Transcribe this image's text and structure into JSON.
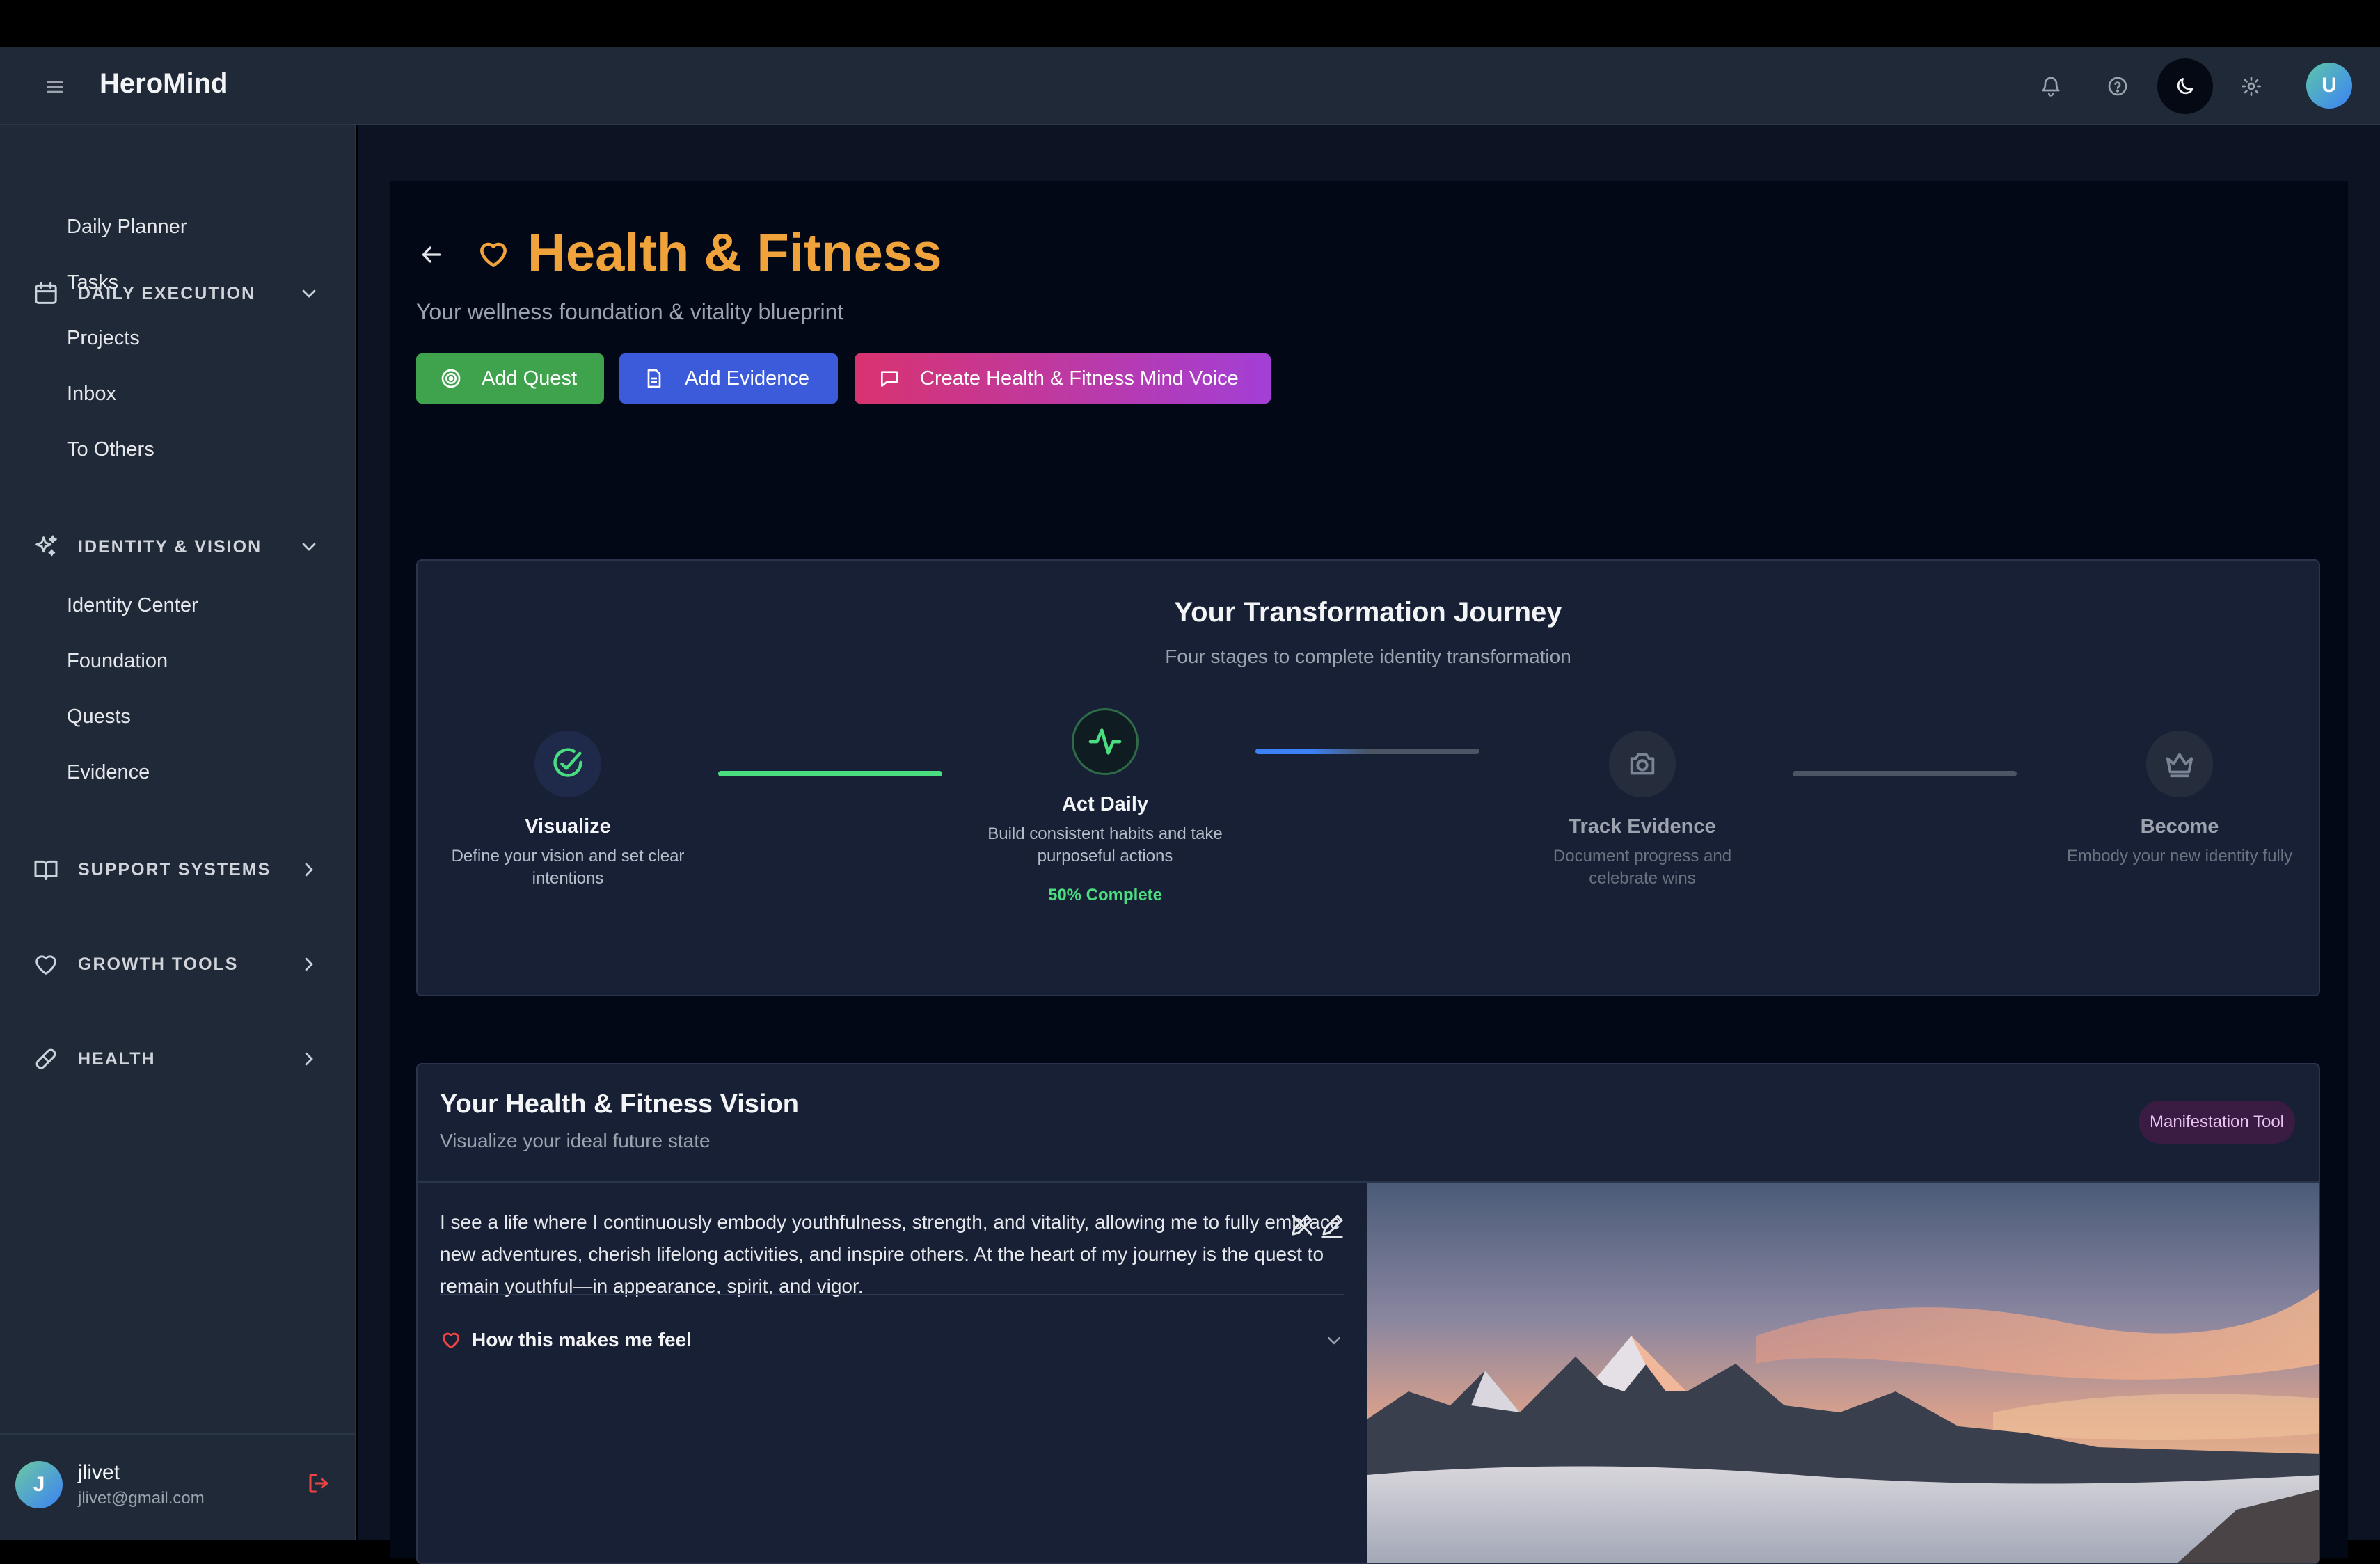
{
  "app": {
    "name": "HeroMind"
  },
  "topbar": {
    "icons": [
      "bell-icon",
      "help-icon",
      "moon-icon",
      "gear-icon"
    ],
    "avatar_initial": "U"
  },
  "sidebar": {
    "sections": [
      {
        "title": "DAILY EXECUTION",
        "icon": "calendar-icon",
        "expanded": true,
        "items": [
          "Daily Planner",
          "Tasks",
          "Projects",
          "Inbox",
          "To Others"
        ]
      },
      {
        "title": "IDENTITY & VISION",
        "icon": "sparkles-icon",
        "expanded": true,
        "items": [
          "Identity Center",
          "Foundation",
          "Quests",
          "Evidence"
        ]
      },
      {
        "title": "SUPPORT SYSTEMS",
        "icon": "book-icon",
        "expanded": false,
        "items": []
      },
      {
        "title": "GROWTH TOOLS",
        "icon": "heart-icon",
        "expanded": false,
        "items": []
      },
      {
        "title": "HEALTH",
        "icon": "pill-icon",
        "expanded": false,
        "items": []
      }
    ],
    "user": {
      "initial": "J",
      "name": "jlivet",
      "email": "jlivet@gmail.com"
    }
  },
  "page": {
    "title": "Health & Fitness",
    "subtitle": "Your wellness foundation & vitality blueprint",
    "buttons": {
      "add_quest": "Add Quest",
      "add_evidence": "Add Evidence",
      "mind_voice": "Create Health & Fitness Mind Voice"
    }
  },
  "journey": {
    "title": "Your Transformation Journey",
    "subtitle": "Four stages to complete identity transformation",
    "stages": [
      {
        "name": "Visualize",
        "desc": "Define your vision and set clear intentions",
        "state": "complete"
      },
      {
        "name": "Act Daily",
        "desc": "Build consistent habits and take purposeful actions",
        "state": "active",
        "progress_label": "50% Complete",
        "progress": 0.5
      },
      {
        "name": "Track Evidence",
        "desc": "Document progress and celebrate wins",
        "state": "locked"
      },
      {
        "name": "Become",
        "desc": "Embody your new identity fully",
        "state": "locked"
      }
    ],
    "colors": {
      "complete": "#4ade80",
      "active": "#3b82f6",
      "inactive": "#4b5563"
    }
  },
  "vision": {
    "title": "Your Health & Fitness Vision",
    "subtitle": "Visualize your ideal future state",
    "badge": "Manifestation Tool",
    "text": "I see a life where I continuously embody youthfulness, strength, and vitality, allowing me to fully embrace new adventures, cherish lifelong activities, and inspire others. At the heart of my journey is the quest to remain youthful—in appearance, spirit, and vigor.",
    "feel_label": "How this makes me feel"
  },
  "colors": {
    "accent_orange": "#f0a33a",
    "green_button": "#3fa34d",
    "blue_button": "#3b5bdb",
    "pink_button_from": "#d9336f",
    "pink_button_to": "#a23fd6"
  }
}
